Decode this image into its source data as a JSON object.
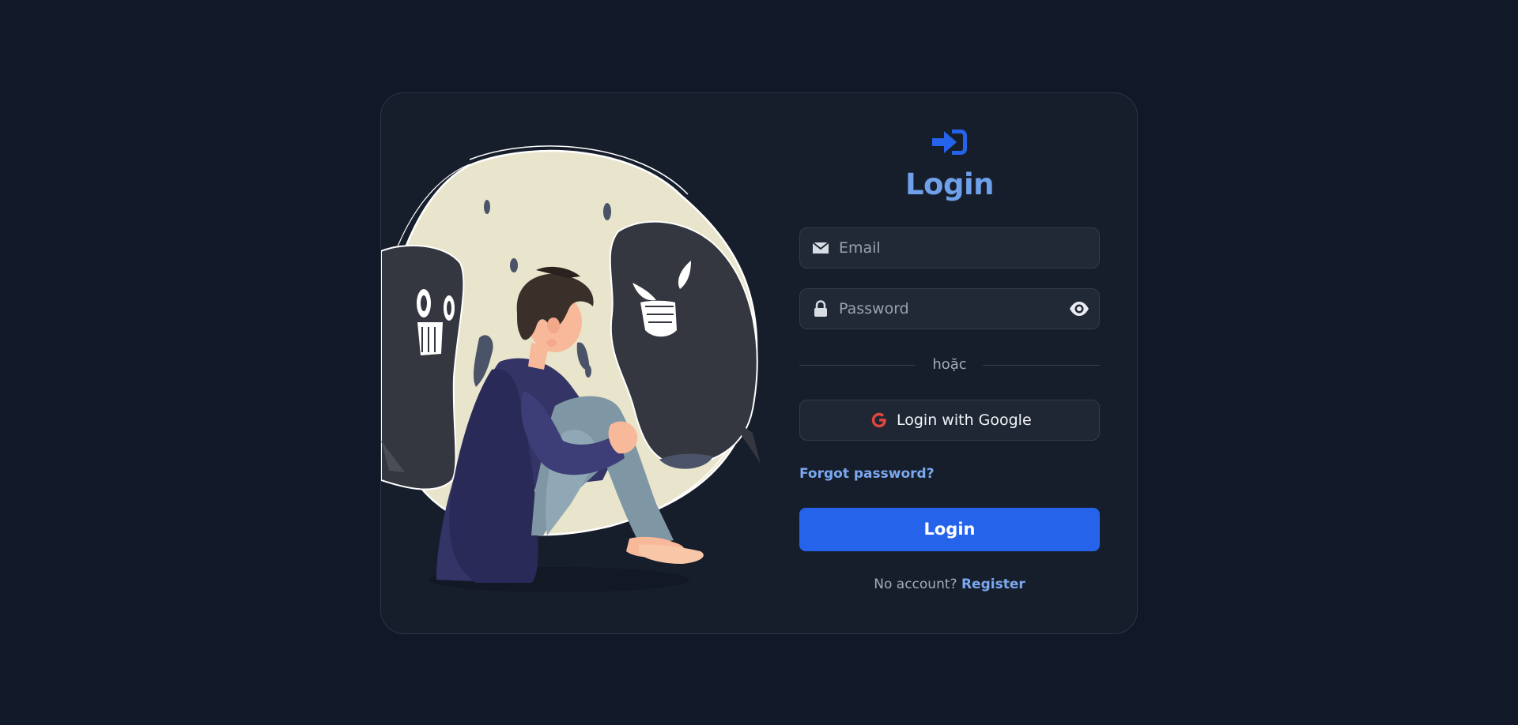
{
  "header": {
    "logo_icon": "sign-in-icon",
    "title": "Login"
  },
  "form": {
    "email": {
      "placeholder": "Email",
      "value": "",
      "icon": "envelope-icon"
    },
    "password": {
      "placeholder": "Password",
      "value": "",
      "icon": "lock-icon",
      "toggle_icon": "eye-icon"
    },
    "divider_text": "hoặc",
    "google_button": {
      "label": "Login with Google",
      "icon": "google-icon"
    },
    "forgot_password": "Forgot password?",
    "submit_label": "Login",
    "register_prompt": "No account?",
    "register_link": "Register"
  },
  "colors": {
    "background": "#111827",
    "card": "#171e2b",
    "accent": "#2563eb",
    "title": "#6fa1ea",
    "link": "#7aa8ef",
    "google_red": "#e1463e"
  },
  "illustration": "sad-boy-with-ghosts-illustration"
}
